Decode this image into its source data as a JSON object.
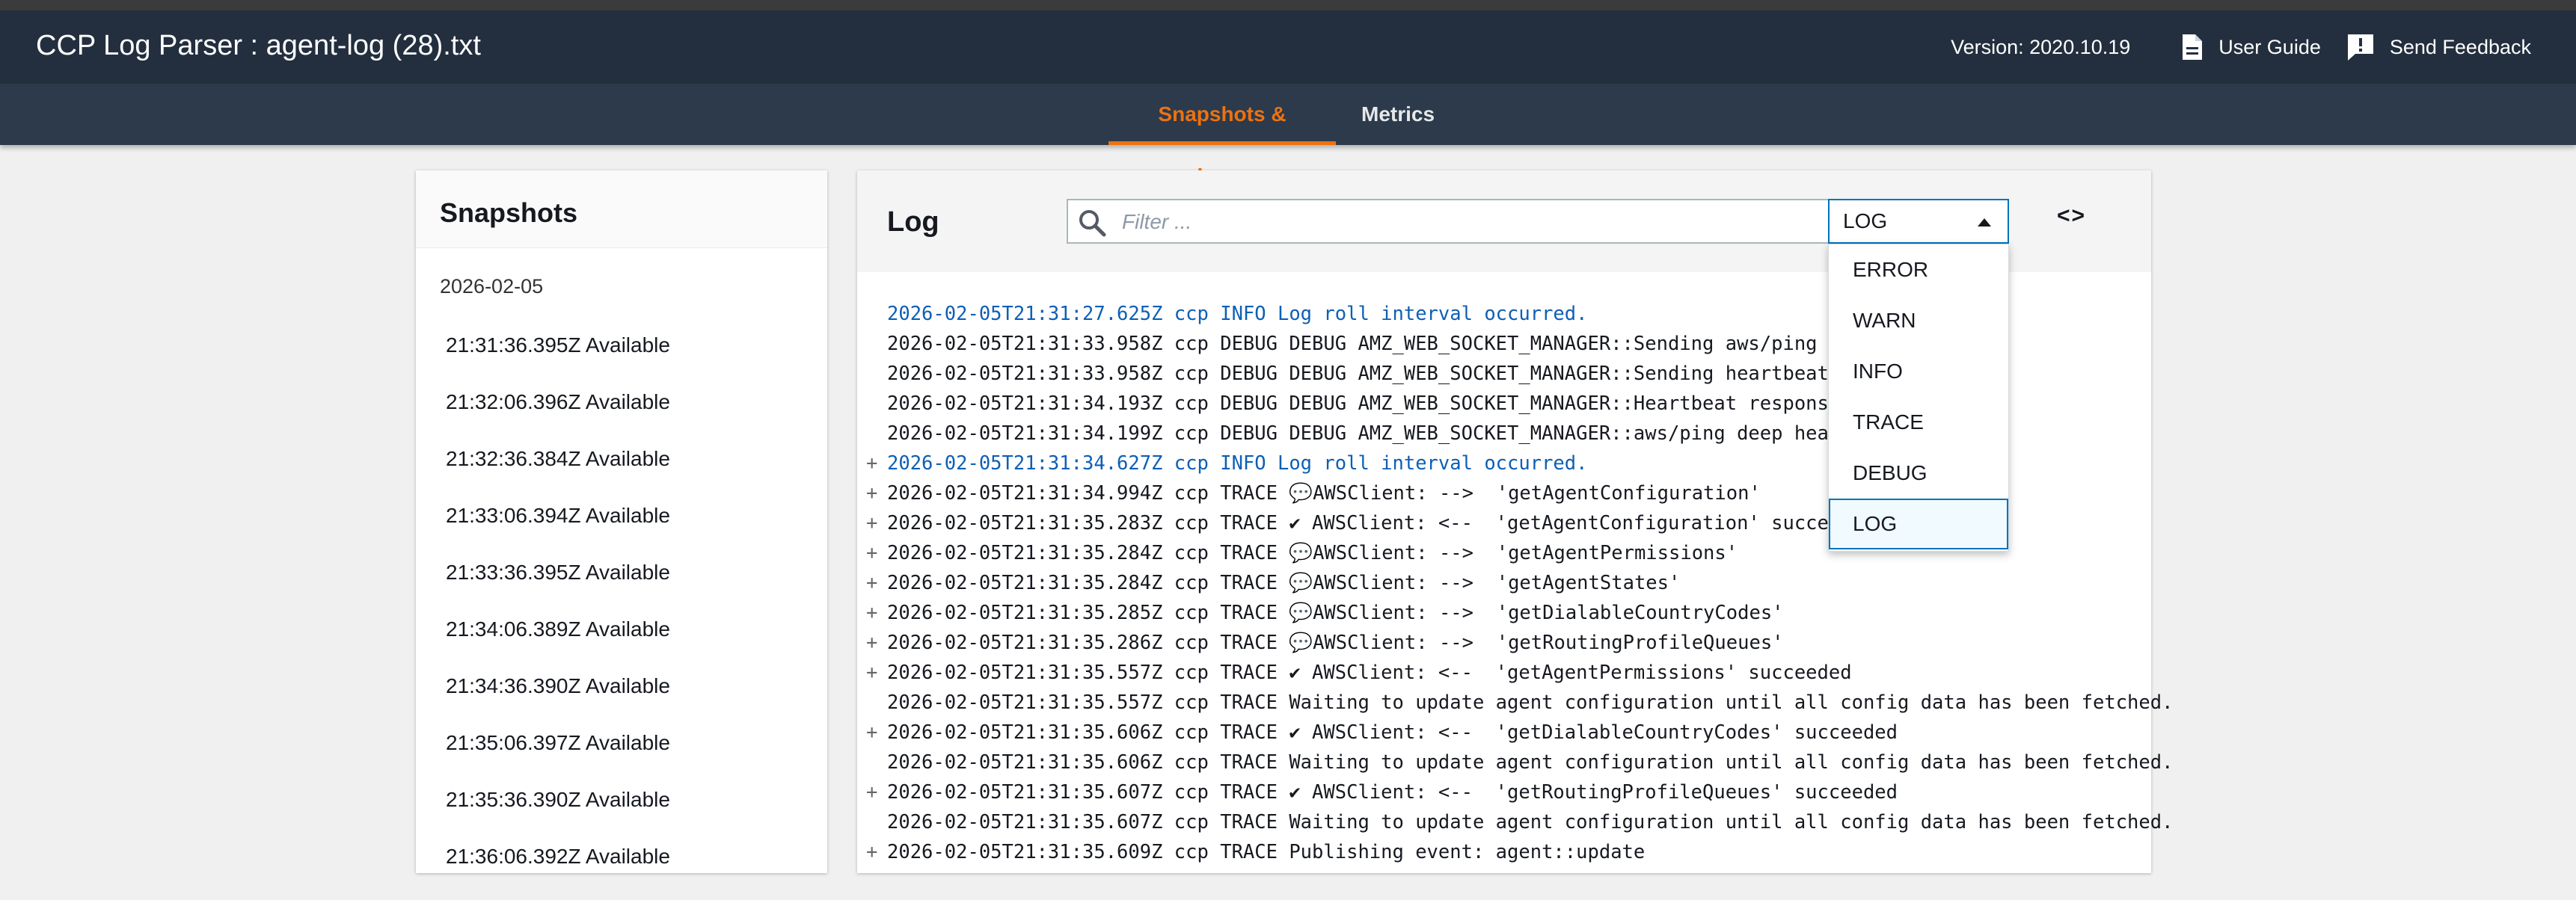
{
  "header": {
    "title": "CCP Log Parser : agent-log (28).txt",
    "version": "Version: 2020.10.19",
    "user_guide": "User Guide",
    "send_feedback": "Send Feedback"
  },
  "tabs": [
    {
      "label": "Snapshots & Logs",
      "active": true
    },
    {
      "label": "Metrics",
      "active": false
    }
  ],
  "snapshots": {
    "title": "Snapshots",
    "date": "2026-02-05",
    "items": [
      "21:31:36.395Z Available",
      "21:32:06.396Z Available",
      "21:32:36.384Z Available",
      "21:33:06.394Z Available",
      "21:33:36.395Z Available",
      "21:34:06.389Z Available",
      "21:34:36.390Z Available",
      "21:35:06.397Z Available",
      "21:35:36.390Z Available",
      "21:36:06.392Z Available"
    ]
  },
  "log": {
    "title": "Log",
    "filter_placeholder": "Filter ...",
    "level_selected": "LOG",
    "expand_icon_label": "<>",
    "level_options": [
      "ERROR",
      "WARN",
      "INFO",
      "TRACE",
      "DEBUG",
      "LOG"
    ],
    "lines": [
      {
        "plus": "",
        "level": "info",
        "text": "2026-02-05T21:31:27.625Z ccp INFO Log roll interval occurred."
      },
      {
        "plus": "",
        "level": "debug",
        "text": "2026-02-05T21:31:33.958Z ccp DEBUG DEBUG AMZ_WEB_SOCKET_MANAGER::Sending aws/ping deep h"
      },
      {
        "plus": "",
        "level": "debug",
        "text": "2026-02-05T21:31:33.958Z ccp DEBUG DEBUG AMZ_WEB_SOCKET_MANAGER::Sending heartbeat"
      },
      {
        "plus": "",
        "level": "debug",
        "text": "2026-02-05T21:31:34.193Z ccp DEBUG DEBUG AMZ_WEB_SOCKET_MANAGER::Heartbeat response rece"
      },
      {
        "plus": "",
        "level": "debug",
        "text": "2026-02-05T21:31:34.199Z ccp DEBUG DEBUG AMZ_WEB_SOCKET_MANAGER::aws/ping deep heartbeat"
      },
      {
        "plus": "+",
        "level": "info",
        "text": "2026-02-05T21:31:34.627Z ccp INFO Log roll interval occurred."
      },
      {
        "plus": "+",
        "level": "trace",
        "text": "2026-02-05T21:31:34.994Z ccp TRACE 💬AWSClient: -->  'getAgentConfiguration'"
      },
      {
        "plus": "+",
        "level": "trace",
        "text": "2026-02-05T21:31:35.283Z ccp TRACE ✔ AWSClient: <--  'getAgentConfiguration' succeeded"
      },
      {
        "plus": "+",
        "level": "trace",
        "text": "2026-02-05T21:31:35.284Z ccp TRACE 💬AWSClient: -->  'getAgentPermissions'"
      },
      {
        "plus": "+",
        "level": "trace",
        "text": "2026-02-05T21:31:35.284Z ccp TRACE 💬AWSClient: -->  'getAgentStates'"
      },
      {
        "plus": "+",
        "level": "trace",
        "text": "2026-02-05T21:31:35.285Z ccp TRACE 💬AWSClient: -->  'getDialableCountryCodes'"
      },
      {
        "plus": "+",
        "level": "trace",
        "text": "2026-02-05T21:31:35.286Z ccp TRACE 💬AWSClient: -->  'getRoutingProfileQueues'"
      },
      {
        "plus": "+",
        "level": "trace",
        "text": "2026-02-05T21:31:35.557Z ccp TRACE ✔ AWSClient: <--  'getAgentPermissions' succeeded"
      },
      {
        "plus": "",
        "level": "trace",
        "text": "2026-02-05T21:31:35.557Z ccp TRACE Waiting to update agent configuration until all config data has been fetched."
      },
      {
        "plus": "+",
        "level": "trace",
        "text": "2026-02-05T21:31:35.606Z ccp TRACE ✔ AWSClient: <--  'getDialableCountryCodes' succeeded"
      },
      {
        "plus": "",
        "level": "trace",
        "text": "2026-02-05T21:31:35.606Z ccp TRACE Waiting to update agent configuration until all config data has been fetched."
      },
      {
        "plus": "+",
        "level": "trace",
        "text": "2026-02-05T21:31:35.607Z ccp TRACE ✔ AWSClient: <--  'getRoutingProfileQueues' succeeded"
      },
      {
        "plus": "",
        "level": "trace",
        "text": "2026-02-05T21:31:35.607Z ccp TRACE Waiting to update agent configuration until all config data has been fetched."
      },
      {
        "plus": "+",
        "level": "trace",
        "text": "2026-02-05T21:31:35.609Z ccp TRACE Publishing event: agent::update"
      }
    ]
  },
  "colors": {
    "header_bg": "#232f3e",
    "tabbar_bg": "#2c3a4b",
    "active_tab": "#ec7211",
    "info_text": "#0d5fb5",
    "select_border": "#0073bb"
  }
}
